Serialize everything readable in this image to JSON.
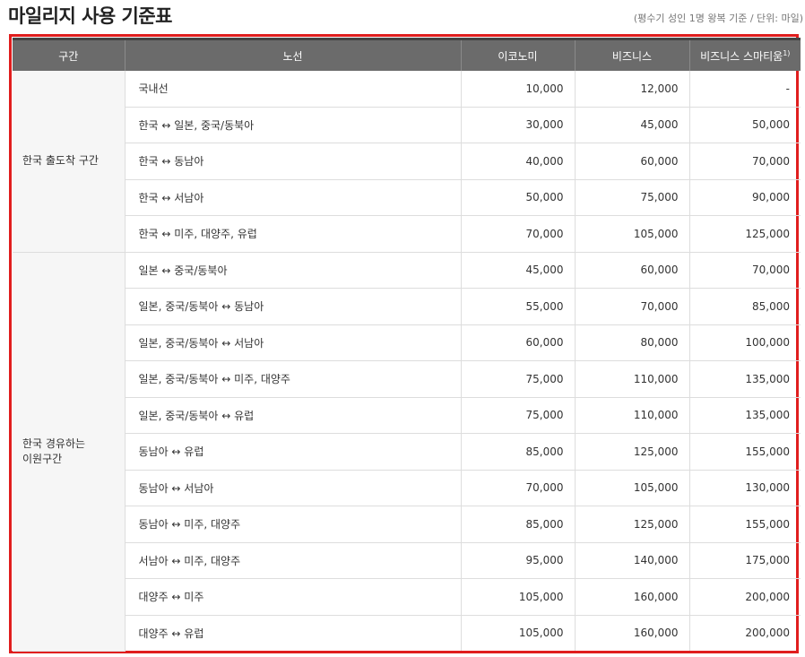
{
  "title": "마일리지 사용 기준표",
  "note": "(평수기 성인 1명 왕복 기준 / 단위: 마일)",
  "headers": {
    "section": "구간",
    "route": "노선",
    "economy": "이코노미",
    "business": "비즈니스",
    "smartium": "비즈니스 스마티움",
    "smartium_sup": "1)"
  },
  "sections": [
    {
      "label": "한국 출도착 구간",
      "rows": [
        {
          "route": "국내선",
          "economy": "10,000",
          "business": "12,000",
          "smartium": "-"
        },
        {
          "route": "한국 ↔ 일본, 중국/동북아",
          "economy": "30,000",
          "business": "45,000",
          "smartium": "50,000"
        },
        {
          "route": "한국 ↔ 동남아",
          "economy": "40,000",
          "business": "60,000",
          "smartium": "70,000"
        },
        {
          "route": "한국 ↔ 서남아",
          "economy": "50,000",
          "business": "75,000",
          "smartium": "90,000"
        },
        {
          "route": "한국 ↔ 미주, 대양주, 유럽",
          "economy": "70,000",
          "business": "105,000",
          "smartium": "125,000"
        }
      ]
    },
    {
      "label": "한국 경유하는 이원구간",
      "rows": [
        {
          "route": "일본 ↔ 중국/동북아",
          "economy": "45,000",
          "business": "60,000",
          "smartium": "70,000"
        },
        {
          "route": "일본, 중국/동북아 ↔ 동남아",
          "economy": "55,000",
          "business": "70,000",
          "smartium": "85,000"
        },
        {
          "route": "일본, 중국/동북아 ↔ 서남아",
          "economy": "60,000",
          "business": "80,000",
          "smartium": "100,000"
        },
        {
          "route": "일본, 중국/동북아 ↔ 미주, 대양주",
          "economy": "75,000",
          "business": "110,000",
          "smartium": "135,000"
        },
        {
          "route": "일본, 중국/동북아 ↔ 유럽",
          "economy": "75,000",
          "business": "110,000",
          "smartium": "135,000"
        },
        {
          "route": "동남아 ↔ 유럽",
          "economy": "85,000",
          "business": "125,000",
          "smartium": "155,000"
        },
        {
          "route": "동남아 ↔ 서남아",
          "economy": "70,000",
          "business": "105,000",
          "smartium": "130,000"
        },
        {
          "route": "동남아 ↔ 미주, 대양주",
          "economy": "85,000",
          "business": "125,000",
          "smartium": "155,000"
        },
        {
          "route": "서남아 ↔ 미주, 대양주",
          "economy": "95,000",
          "business": "140,000",
          "smartium": "175,000"
        },
        {
          "route": "대양주 ↔ 미주",
          "economy": "105,000",
          "business": "160,000",
          "smartium": "200,000"
        },
        {
          "route": "대양주 ↔ 유럽",
          "economy": "105,000",
          "business": "160,000",
          "smartium": "200,000"
        }
      ]
    }
  ],
  "colors": {
    "frame": "#e01e1e",
    "header_bg": "#6b6b6b",
    "section_bg": "#f6f6f6"
  }
}
